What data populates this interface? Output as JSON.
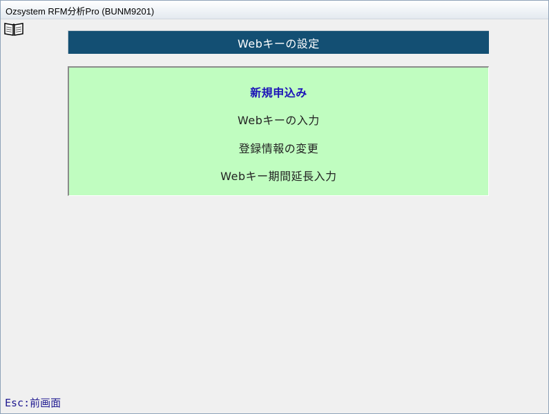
{
  "window": {
    "title": "Ozsystem RFM分析Pro (BUNM9201)"
  },
  "header": {
    "title": "Webキーの設定"
  },
  "menu": {
    "items": [
      {
        "label": "新規申込み",
        "selected": true
      },
      {
        "label": "Webキーの入力",
        "selected": false
      },
      {
        "label": "登録情報の変更",
        "selected": false
      },
      {
        "label": "Webキー期間延長入力",
        "selected": false
      }
    ]
  },
  "footer": {
    "hint": "Esc:前画面"
  },
  "icons": {
    "help": "book-icon"
  },
  "colors": {
    "header_bg": "#134f73",
    "panel_bg": "#c0fdc0",
    "selected_text": "#1b12b8",
    "footer_text": "#1e1890"
  }
}
